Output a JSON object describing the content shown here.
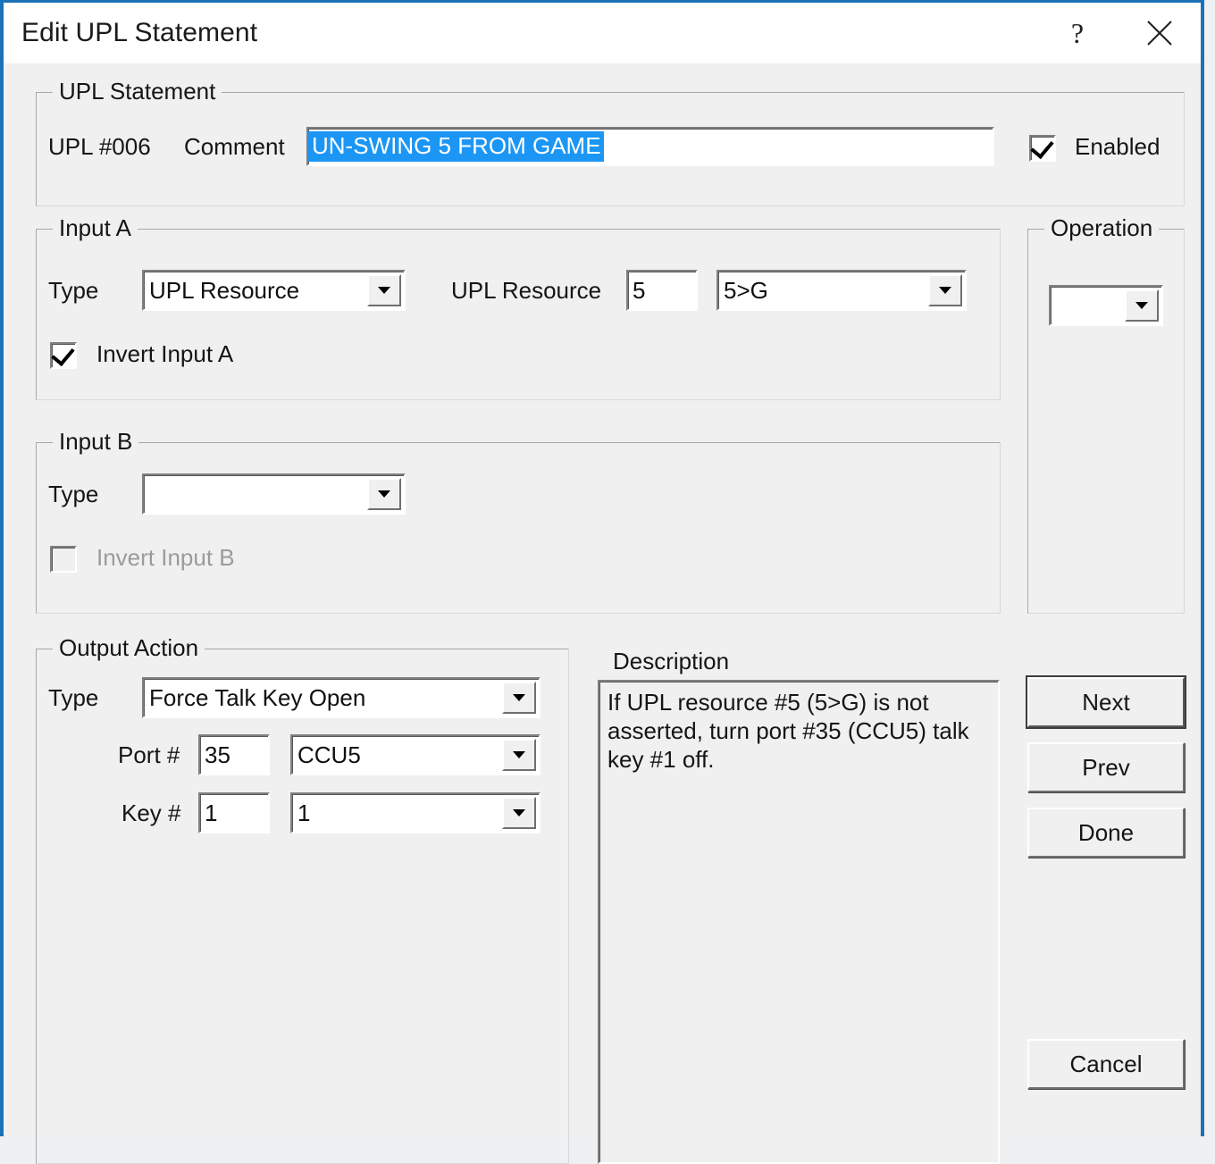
{
  "window": {
    "title": "Edit UPL Statement",
    "help_icon": "question-mark-icon",
    "close_icon": "close-icon",
    "accent_color": "#1a72b8",
    "face_color": "#f0f0f0",
    "selection_color": "#1c96f5"
  },
  "upl_statement": {
    "group_label": "UPL Statement",
    "number_label": "UPL #006",
    "comment_label": "Comment",
    "comment_value": "UN-SWING 5 FROM GAME",
    "comment_placeholder": "",
    "enabled_label": "Enabled",
    "enabled_checked": true
  },
  "input_a": {
    "group_label": "Input A",
    "type_label": "Type",
    "type_value": "UPL Resource",
    "resource_label": "UPL Resource",
    "resource_number": "5",
    "resource_value": "5>G",
    "invert_label": "Invert Input A",
    "invert_checked": true,
    "dropdown_icon": "chevron-down-icon"
  },
  "input_b": {
    "group_label": "Input B",
    "type_label": "Type",
    "type_value": "",
    "invert_label": "Invert Input B",
    "invert_checked": false,
    "invert_disabled": true,
    "dropdown_icon": "chevron-down-icon"
  },
  "operation": {
    "group_label": "Operation",
    "value": "",
    "dropdown_icon": "chevron-down-icon"
  },
  "output_action": {
    "group_label": "Output Action",
    "type_label": "Type",
    "type_value": "Force Talk Key Open",
    "port_label": "Port #",
    "port_number": "35",
    "port_value": "CCU5",
    "key_label": "Key #",
    "key_number": "1",
    "key_value": "1",
    "dropdown_icon": "chevron-down-icon"
  },
  "description": {
    "label": "Description",
    "text": "If UPL resource #5 (5>G) is not asserted, turn port #35 (CCU5) talk key #1 off."
  },
  "buttons": {
    "next": "Next",
    "prev": "Prev",
    "done": "Done",
    "cancel": "Cancel"
  }
}
